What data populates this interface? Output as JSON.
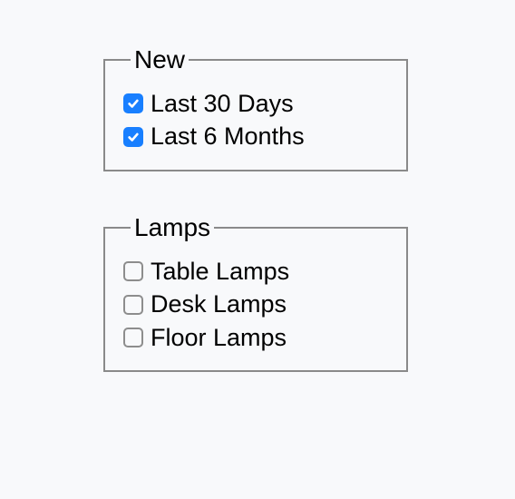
{
  "groups": [
    {
      "legend": "New",
      "options": [
        {
          "label": "Last 30 Days",
          "checked": true
        },
        {
          "label": "Last 6 Months",
          "checked": true
        }
      ]
    },
    {
      "legend": "Lamps",
      "options": [
        {
          "label": "Table Lamps",
          "checked": false
        },
        {
          "label": "Desk Lamps",
          "checked": false
        },
        {
          "label": "Floor Lamps",
          "checked": false
        }
      ]
    }
  ]
}
